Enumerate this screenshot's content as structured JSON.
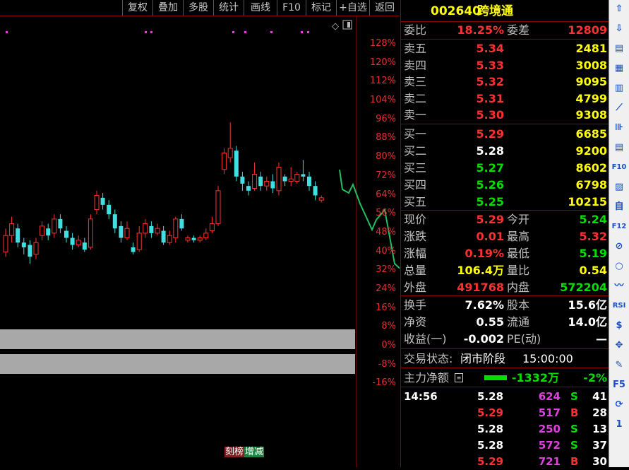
{
  "toolbar": {
    "buttons": [
      "复权",
      "叠加",
      "多股",
      "统计",
      "画线",
      "F10",
      "标记",
      "+自选",
      "返回"
    ]
  },
  "stock": {
    "code": "002640",
    "name": "跨境通"
  },
  "commission": {
    "ratio_label": "委比",
    "ratio": "18.25%",
    "diff_label": "委差",
    "diff": "12809"
  },
  "asks": [
    {
      "label": "卖五",
      "price": "5.34",
      "vol": "2481",
      "pc": "red"
    },
    {
      "label": "卖四",
      "price": "5.33",
      "vol": "3008",
      "pc": "red"
    },
    {
      "label": "卖三",
      "price": "5.32",
      "vol": "9095",
      "pc": "red"
    },
    {
      "label": "卖二",
      "price": "5.31",
      "vol": "4799",
      "pc": "red"
    },
    {
      "label": "卖一",
      "price": "5.30",
      "vol": "9308",
      "pc": "red"
    }
  ],
  "bids": [
    {
      "label": "买一",
      "price": "5.29",
      "vol": "6685",
      "pc": "red"
    },
    {
      "label": "买二",
      "price": "5.28",
      "vol": "9200",
      "pc": "white"
    },
    {
      "label": "买三",
      "price": "5.27",
      "vol": "8602",
      "pc": "green"
    },
    {
      "label": "买四",
      "price": "5.26",
      "vol": "6798",
      "pc": "green"
    },
    {
      "label": "买五",
      "price": "5.25",
      "vol": "10215",
      "pc": "green"
    }
  ],
  "quote": [
    {
      "l1": "现价",
      "v1": "5.29",
      "c1": "red",
      "l2": "今开",
      "v2": "5.24",
      "c2": "green"
    },
    {
      "l1": "涨跌",
      "v1": "0.01",
      "c1": "red",
      "l2": "最高",
      "v2": "5.32",
      "c2": "red"
    },
    {
      "l1": "涨幅",
      "v1": "0.19%",
      "c1": "red",
      "l2": "最低",
      "v2": "5.19",
      "c2": "green"
    },
    {
      "l1": "总量",
      "v1": "106.4万",
      "c1": "yellow",
      "l2": "量比",
      "v2": "0.54",
      "c2": "yellow"
    },
    {
      "l1": "外盘",
      "v1": "491768",
      "c1": "red",
      "l2": "内盘",
      "v2": "572204",
      "c2": "green"
    }
  ],
  "fund": [
    {
      "l1": "换手",
      "v1": "7.62%",
      "l2": "股本",
      "v2": "15.6亿"
    },
    {
      "l1": "净资",
      "v1": "0.55",
      "l2": "流通",
      "v2": "14.0亿"
    },
    {
      "l1": "收益(一)",
      "v1": "-0.002",
      "l2": "PE(动)",
      "v2": "—"
    }
  ],
  "trade_status": {
    "label": "交易状态:",
    "value": "闭市阶段",
    "time": "15:00:00"
  },
  "main_force": {
    "label": "主力净额",
    "amount": "-1332万",
    "pct": "-2%"
  },
  "ticks": [
    {
      "time": "14:56",
      "price": "5.28",
      "pc": "white",
      "vol": "624",
      "bs": "S",
      "n": "41"
    },
    {
      "time": "",
      "price": "5.29",
      "pc": "red",
      "vol": "517",
      "bs": "B",
      "n": "28"
    },
    {
      "time": "",
      "price": "5.28",
      "pc": "white",
      "vol": "250",
      "bs": "S",
      "n": "13"
    },
    {
      "time": "",
      "price": "5.28",
      "pc": "white",
      "vol": "572",
      "bs": "S",
      "n": "37"
    },
    {
      "time": "",
      "price": "5.29",
      "pc": "red",
      "vol": "721",
      "bs": "B",
      "n": "30"
    }
  ],
  "chart_data": {
    "type": "candlestick",
    "y_ticks": [
      "128%",
      "120%",
      "112%",
      "104%",
      "96%",
      "88%",
      "80%",
      "72%",
      "64%",
      "56%",
      "48%",
      "40%",
      "32%",
      "24%",
      "16%",
      "8%",
      "0%",
      "-8%",
      "-16%"
    ],
    "bottom_labels": [
      "刻榜",
      "增减"
    ],
    "candles": [
      {
        "o": 40,
        "c": 47,
        "h": 50,
        "l": 38
      },
      {
        "o": 47,
        "c": 52,
        "h": 55,
        "l": 44
      },
      {
        "o": 50,
        "c": 44,
        "h": 52,
        "l": 42
      },
      {
        "o": 44,
        "c": 42,
        "h": 46,
        "l": 39
      },
      {
        "o": 43,
        "c": 38,
        "h": 45,
        "l": 35
      },
      {
        "o": 39,
        "c": 44,
        "h": 46,
        "l": 37
      },
      {
        "o": 47,
        "c": 51,
        "h": 53,
        "l": 45
      },
      {
        "o": 50,
        "c": 47,
        "h": 52,
        "l": 45
      },
      {
        "o": 48,
        "c": 54,
        "h": 56,
        "l": 46
      },
      {
        "o": 54,
        "c": 50,
        "h": 56,
        "l": 48
      },
      {
        "o": 49,
        "c": 46,
        "h": 51,
        "l": 44
      },
      {
        "o": 46,
        "c": 43,
        "h": 48,
        "l": 41
      },
      {
        "o": 43,
        "c": 45,
        "h": 47,
        "l": 42
      },
      {
        "o": 44,
        "c": 41,
        "h": 46,
        "l": 40
      },
      {
        "o": 42,
        "c": 54,
        "h": 56,
        "l": 41
      },
      {
        "o": 58,
        "c": 64,
        "h": 66,
        "l": 56
      },
      {
        "o": 63,
        "c": 60,
        "h": 65,
        "l": 58
      },
      {
        "o": 60,
        "c": 56,
        "h": 62,
        "l": 54
      },
      {
        "o": 56,
        "c": 50,
        "h": 58,
        "l": 48
      },
      {
        "o": 51,
        "c": 46,
        "h": 53,
        "l": 44
      },
      {
        "o": 46,
        "c": 50,
        "h": 53,
        "l": 45
      },
      {
        "o": 42,
        "c": 40,
        "h": 44,
        "l": 39
      },
      {
        "o": 41,
        "c": 48,
        "h": 51,
        "l": 40
      },
      {
        "o": 48,
        "c": 52,
        "h": 54,
        "l": 46
      },
      {
        "o": 51,
        "c": 48,
        "h": 53,
        "l": 46
      },
      {
        "o": 48,
        "c": 50,
        "h": 52,
        "l": 47
      },
      {
        "o": 49,
        "c": 44,
        "h": 51,
        "l": 43
      },
      {
        "o": 44,
        "c": 47,
        "h": 49,
        "l": 43
      },
      {
        "o": 46,
        "c": 54,
        "h": 55,
        "l": 44
      },
      {
        "o": 54,
        "c": 50,
        "h": 56,
        "l": 49
      },
      {
        "o": 45,
        "c": 46,
        "h": 47,
        "l": 44
      },
      {
        "o": 46,
        "c": 45,
        "h": 47,
        "l": 44
      },
      {
        "o": 45,
        "c": 46,
        "h": 47,
        "l": 44
      },
      {
        "o": 46,
        "c": 48,
        "h": 50,
        "l": 45
      },
      {
        "o": 49,
        "c": 52,
        "h": 55,
        "l": 48
      },
      {
        "o": 52,
        "c": 66,
        "h": 68,
        "l": 51
      },
      {
        "o": 75,
        "c": 82,
        "h": 84,
        "l": 73
      },
      {
        "o": 80,
        "c": 84,
        "h": 95,
        "l": 78
      },
      {
        "o": 83,
        "c": 72,
        "h": 85,
        "l": 70
      },
      {
        "o": 72,
        "c": 69,
        "h": 74,
        "l": 66
      },
      {
        "o": 68,
        "c": 66,
        "h": 70,
        "l": 64
      },
      {
        "o": 67,
        "c": 73,
        "h": 78,
        "l": 66
      },
      {
        "o": 72,
        "c": 68,
        "h": 74,
        "l": 66
      },
      {
        "o": 68,
        "c": 70,
        "h": 72,
        "l": 66
      },
      {
        "o": 70,
        "c": 67,
        "h": 73,
        "l": 65
      },
      {
        "o": 66,
        "c": 76,
        "h": 78,
        "l": 64
      },
      {
        "o": 72,
        "c": 70,
        "h": 73,
        "l": 68
      },
      {
        "o": 70,
        "c": 71,
        "h": 76,
        "l": 68
      },
      {
        "o": 70,
        "c": 73,
        "h": 74,
        "l": 69
      },
      {
        "o": 73,
        "c": 72,
        "h": 79,
        "l": 70
      },
      {
        "o": 72,
        "c": 68,
        "h": 74,
        "l": 66
      },
      {
        "o": 68,
        "c": 64,
        "h": 70,
        "l": 62
      },
      {
        "o": 62,
        "c": 63,
        "h": 64,
        "l": 61
      }
    ]
  },
  "sidebar_icons": [
    "up-arrow",
    "down-arrow",
    "doc",
    "chart",
    "grid",
    "line",
    "candle",
    "doc2",
    "F10",
    "trend",
    "self",
    "F12",
    "stat",
    "circle",
    "wave",
    "RSI",
    "S",
    "move",
    "pen",
    "F5",
    "refresh",
    "1"
  ]
}
